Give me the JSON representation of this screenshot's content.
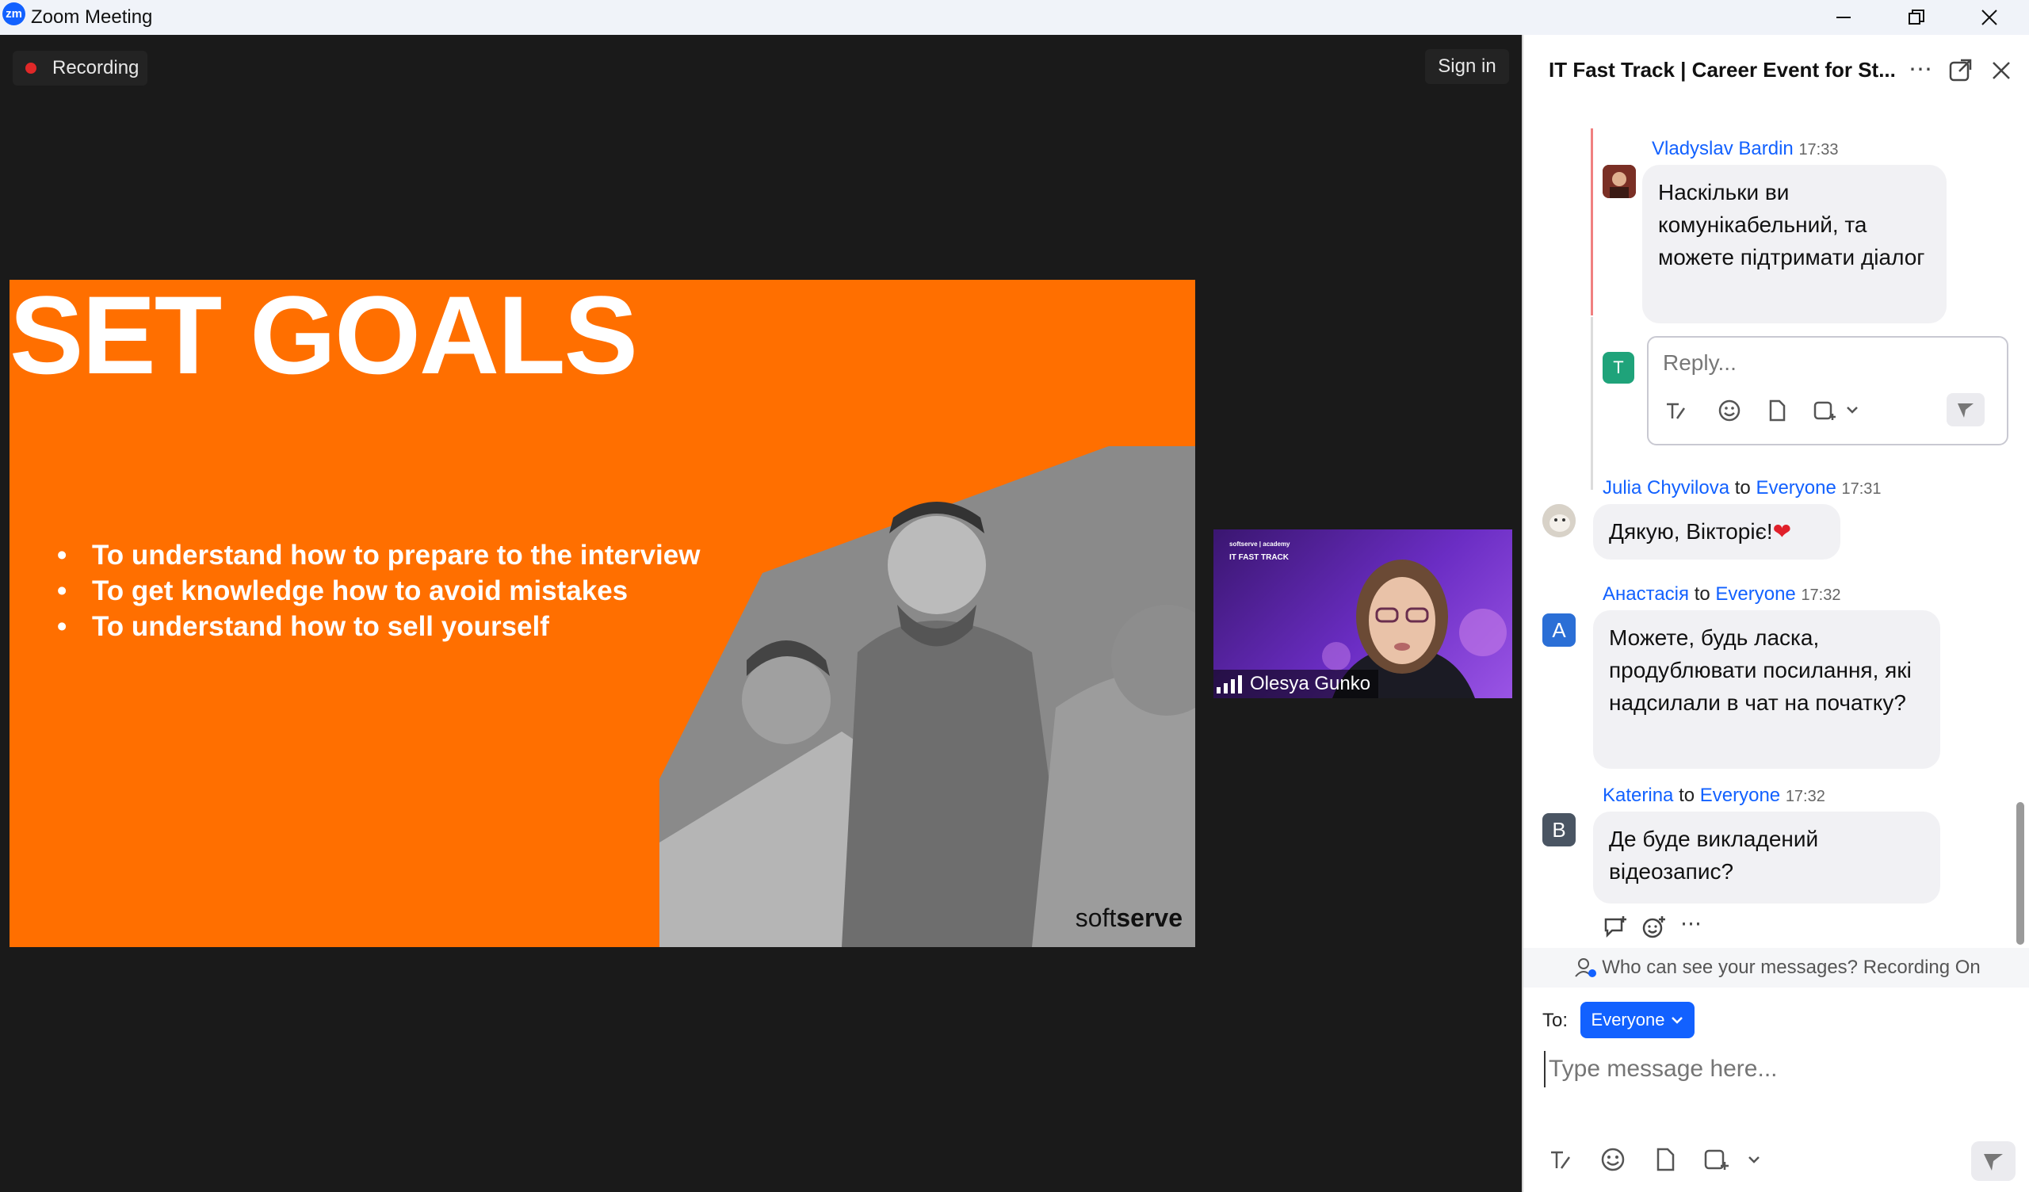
{
  "window": {
    "logo": "zm",
    "title": "Zoom Meeting",
    "minimize_icon": "minimize-icon",
    "restore_icon": "restore-icon",
    "close_icon": "close-icon"
  },
  "meeting": {
    "recording_label": "Recording",
    "sign_in_label": "Sign in"
  },
  "slide": {
    "title": "SET GOALS",
    "bullets": [
      "To understand how to prepare to the interview",
      "To get knowledge how to avoid mistakes",
      "To understand how to sell yourself"
    ],
    "brand_soft": "soft",
    "brand_serve": "serve"
  },
  "video_tile": {
    "brand_text": "softserve | academy",
    "caption": "IT FAST TRACK",
    "participant_name": "Olesya Gunko"
  },
  "chat": {
    "title": "IT Fast Track | Career Event for St...",
    "messages": [
      {
        "sender": "Vladyslav Bardin",
        "time": "17:33",
        "text": "Наскільки  ви комунікабельний, та можете підтримати діалог"
      },
      {
        "sender": "Julia Chyvilova",
        "to_word": "to",
        "recipient": "Everyone",
        "time": "17:31",
        "text": "Дякую, Вікторіє!",
        "emoji": "❤"
      },
      {
        "avatar_letter": "A",
        "sender": "Анастасія",
        "to_word": "to",
        "recipient": "Everyone",
        "time": "17:32",
        "text": "Можете, будь ласка, продублювати посилання, які надсилали в чат на початку?"
      },
      {
        "avatar_letter": "B",
        "sender": "Katerina",
        "to_word": "to",
        "recipient": "Everyone",
        "time": "17:32",
        "text": "Де буде викладений відеозапис?"
      }
    ],
    "reply_avatar_letter": "T",
    "reply_placeholder": "Reply...",
    "privacy_notice": "Who can see your messages? Recording On",
    "to_label": "To:",
    "recipient_select": "Everyone",
    "compose_placeholder": "Type message here...",
    "colors": {
      "accent": "#1261ff",
      "avatar_t": "#1fa37a",
      "avatar_a": "#2b6fd6",
      "avatar_b": "#4a5563"
    }
  }
}
